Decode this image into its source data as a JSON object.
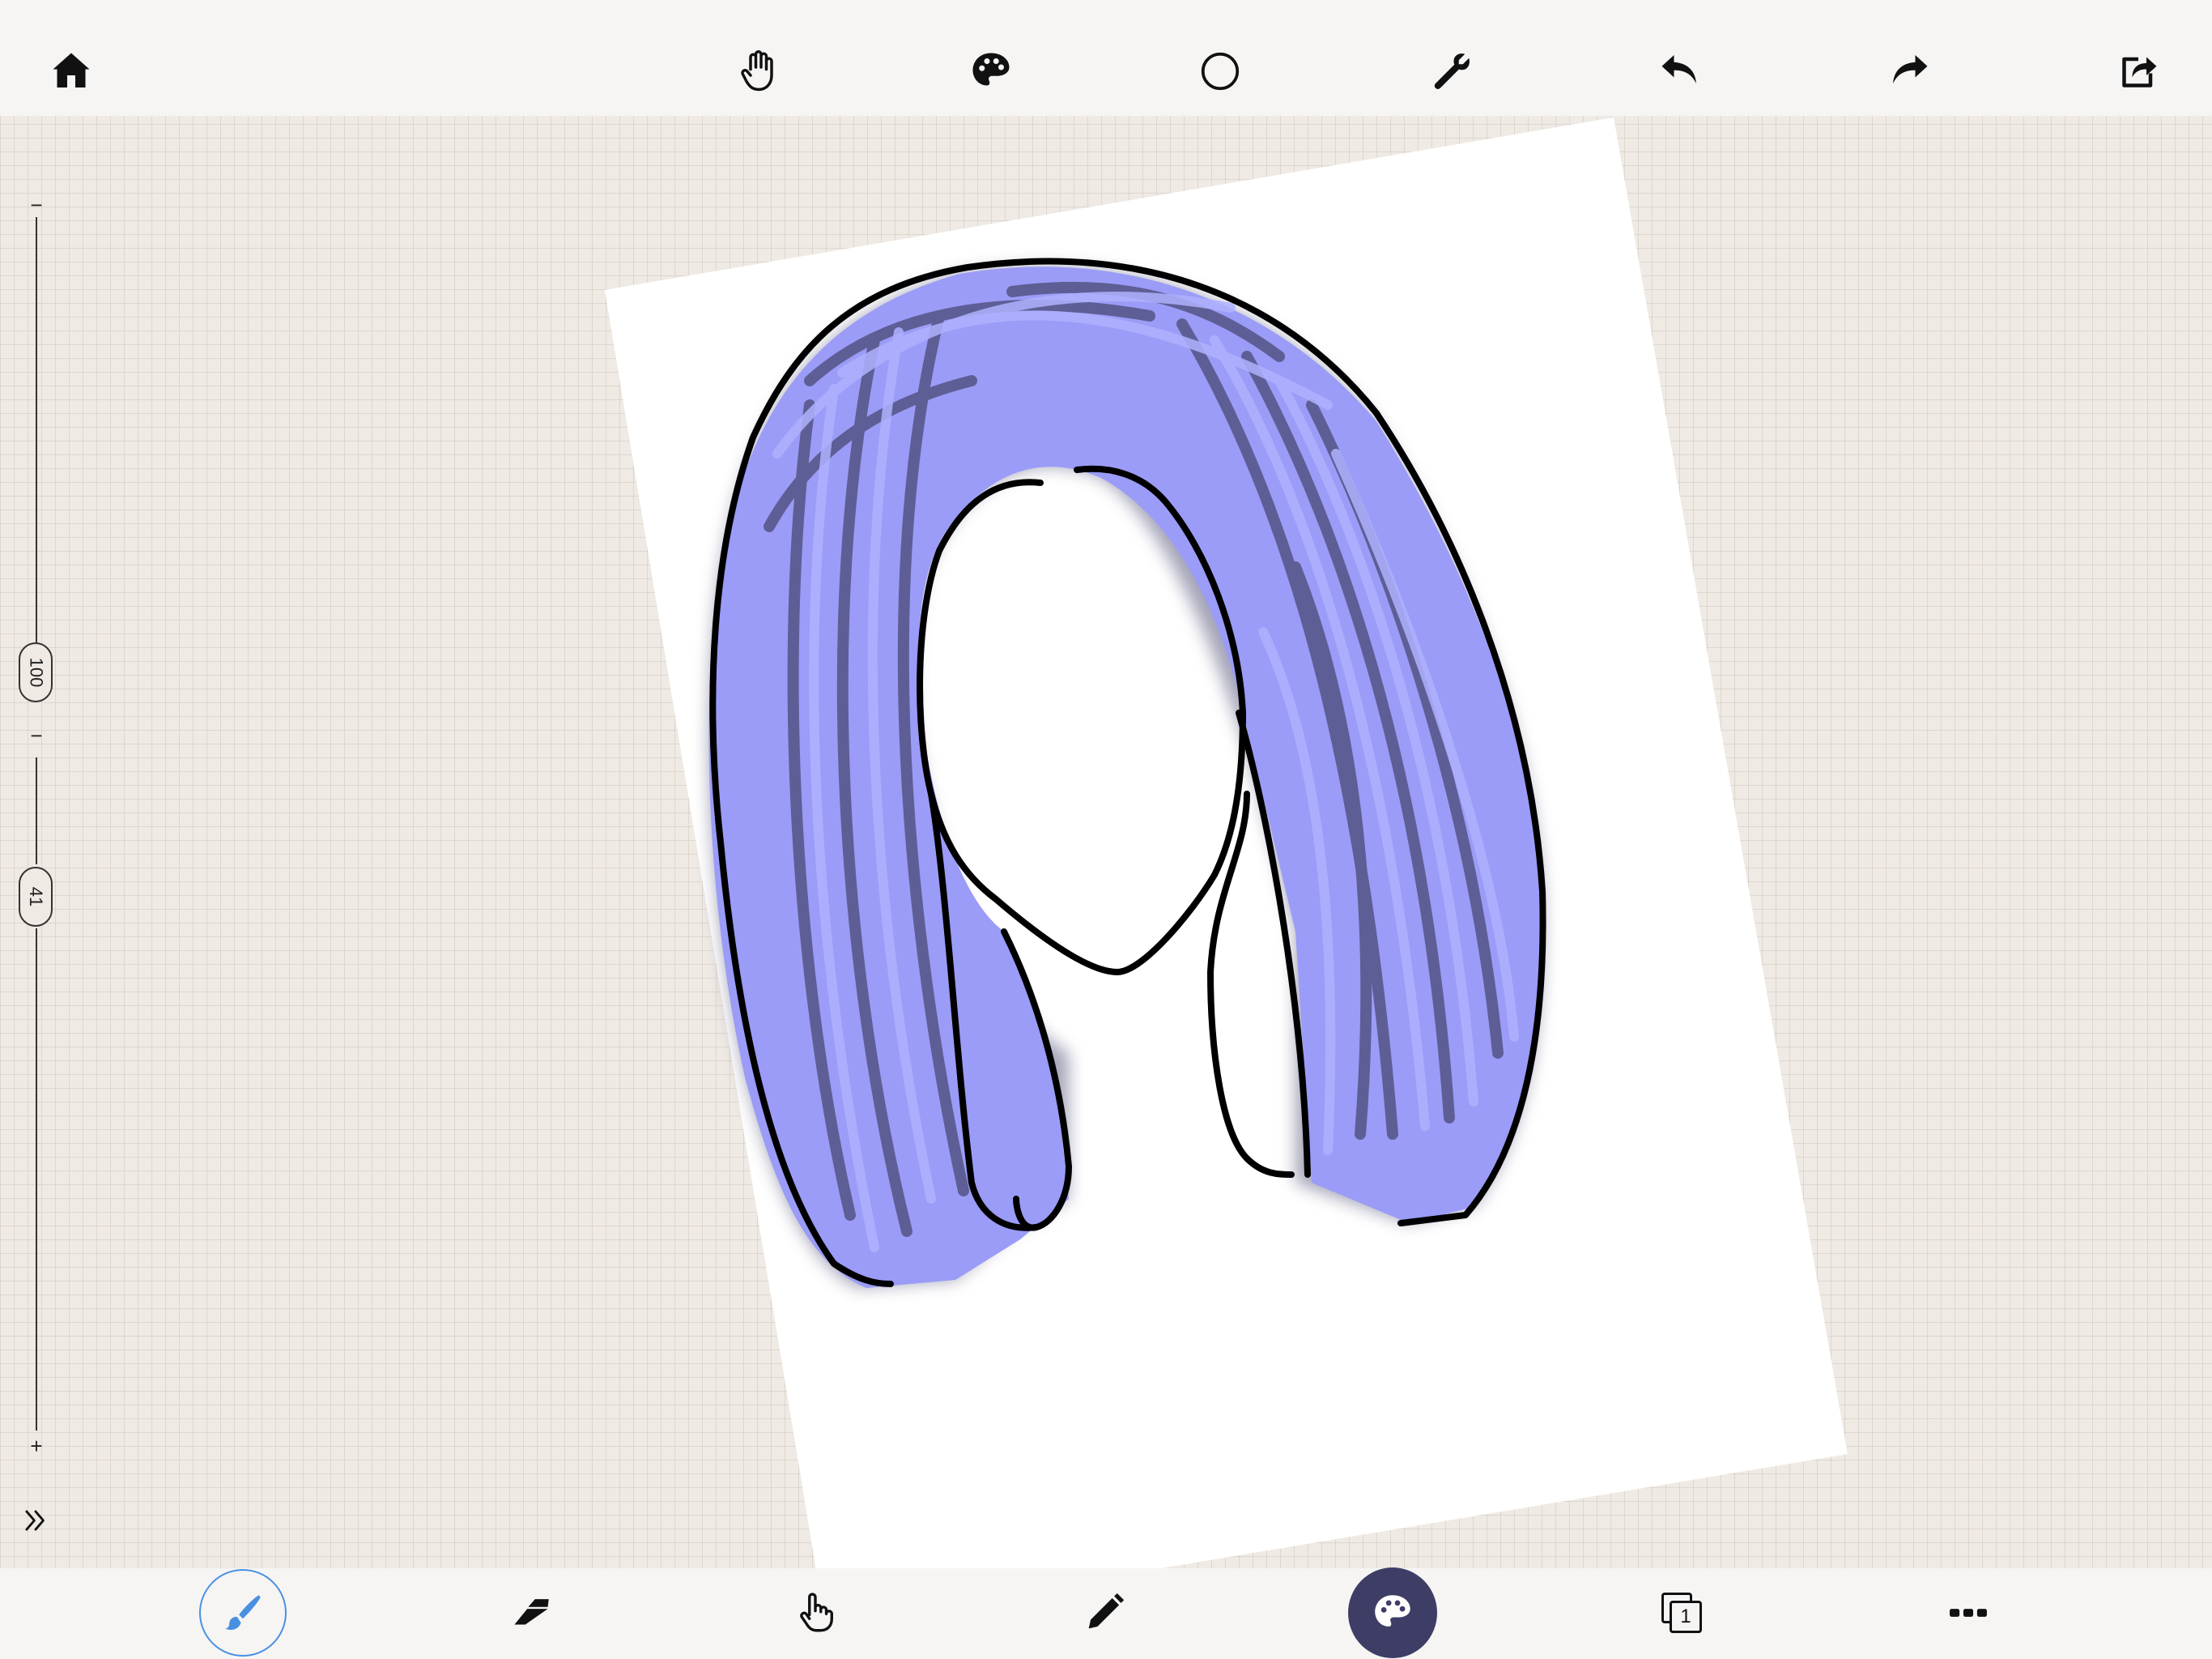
{
  "app": {
    "accent_color": "#4a90e2",
    "selected_color": "#3e3d66",
    "brush_paint_color": "#9b9cf7"
  },
  "toolbar": {
    "home_icon": "home-icon",
    "pan_icon": "hand-icon",
    "palette_icon": "palette-icon",
    "shape_icon": "circle-icon",
    "settings_icon": "wrench-icon",
    "undo_icon": "undo-icon",
    "redo_icon": "redo-icon",
    "share_icon": "share-icon"
  },
  "side_slider": {
    "top_tick": "−",
    "size_value": "100",
    "mid_tick": "−",
    "opacity_value": "41",
    "bottom_tick": "+",
    "expand_icon": "double-chevron-right-icon"
  },
  "bottom_tools": {
    "brush_icon": "brush-icon",
    "eraser_icon": "eraser-icon",
    "smudge_icon": "finger-icon",
    "pencil_icon": "pencil-icon",
    "color_icon": "palette-icon",
    "layers_count": "1",
    "more_icon": "more-icon"
  }
}
